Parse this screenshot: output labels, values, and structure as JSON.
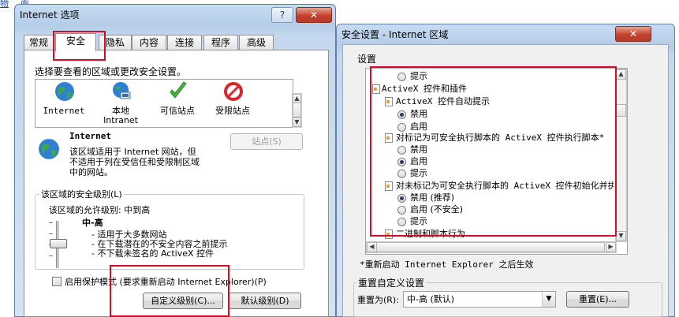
{
  "page_top": {
    "link1": "物",
    "link2": "面"
  },
  "left_window": {
    "title": "Internet 选项",
    "help_btn": "?",
    "close_btn": "✕",
    "tabs": [
      {
        "label": "常规"
      },
      {
        "label": "安全"
      },
      {
        "label": "隐私"
      },
      {
        "label": "内容"
      },
      {
        "label": "连接"
      },
      {
        "label": "程序"
      },
      {
        "label": "高级"
      }
    ],
    "zone_prompt": "选择要查看的区域或更改安全设置。",
    "zones": [
      {
        "label": "Internet",
        "icon": "globe-icon"
      },
      {
        "label": "本地\nIntranet",
        "icon": "intranet-icon"
      },
      {
        "label": "可信站点",
        "icon": "checkmark-icon"
      },
      {
        "label": "受限站点",
        "icon": "no-entry-icon"
      }
    ],
    "zone_title": "Internet",
    "zone_desc_1": "该区域适用于 Internet 网站，但",
    "zone_desc_2": "不适用于列在受信任和受限制区域",
    "zone_desc_3": "中的网站。",
    "sites_btn": "站点(S)",
    "security_group_label": "该区域的安全级别(L)",
    "allowed_level": "该区域的允许级别: 中到高",
    "level_name": "中-高",
    "level_lines": [
      "- 适用于大多数网站",
      "- 在下载潜在的不安全内容之前提示",
      "- 不下载未签名的 ActiveX 控件"
    ],
    "protected_mode": "启用保护模式 (要求重新启动 Internet Explorer)(P)",
    "custom_level_btn": "自定义级别(C)...",
    "default_level_btn": "默认级别(D)"
  },
  "right_window": {
    "title": "安全设置 - Internet 区域",
    "close_btn": "✕",
    "settings_label": "设置",
    "settings_rows": [
      {
        "kind": "radio",
        "label": "提示",
        "checked": false,
        "indent": 1
      },
      {
        "kind": "header",
        "label": "ActiveX 控件和插件",
        "indent": 0
      },
      {
        "kind": "header",
        "label": "ActiveX 控件自动提示",
        "indent": 1
      },
      {
        "kind": "radio",
        "label": "禁用",
        "checked": true,
        "indent": 1
      },
      {
        "kind": "radio",
        "label": "启用",
        "checked": false,
        "indent": 1
      },
      {
        "kind": "header",
        "label": "对标记为可安全执行脚本的 ActiveX 控件执行脚本*",
        "indent": 1
      },
      {
        "kind": "radio",
        "label": "禁用",
        "checked": false,
        "indent": 1
      },
      {
        "kind": "radio",
        "label": "启用",
        "checked": true,
        "indent": 1
      },
      {
        "kind": "radio",
        "label": "提示",
        "checked": false,
        "indent": 1
      },
      {
        "kind": "header",
        "label": "对未标记为可安全执行脚本的 ActiveX 控件初始化并执",
        "indent": 1
      },
      {
        "kind": "radio",
        "label": "禁用 (推荐)",
        "checked": true,
        "indent": 1
      },
      {
        "kind": "radio",
        "label": "启用 (不安全)",
        "checked": false,
        "indent": 1
      },
      {
        "kind": "radio",
        "label": "提示",
        "checked": false,
        "indent": 1
      },
      {
        "kind": "header",
        "label": "二进制和脚本行为",
        "indent": 1
      }
    ],
    "restart_note": "*重新启动 Internet Explorer 之后生效",
    "reset_group_label": "重置自定义设置",
    "reset_to_label": "重置为(R):",
    "reset_value": "中-高 (默认)",
    "reset_btn": "重置(E)..."
  },
  "colors": {
    "highlight_box": "#d40b2a",
    "title_gradient": "#c7dcf2"
  }
}
